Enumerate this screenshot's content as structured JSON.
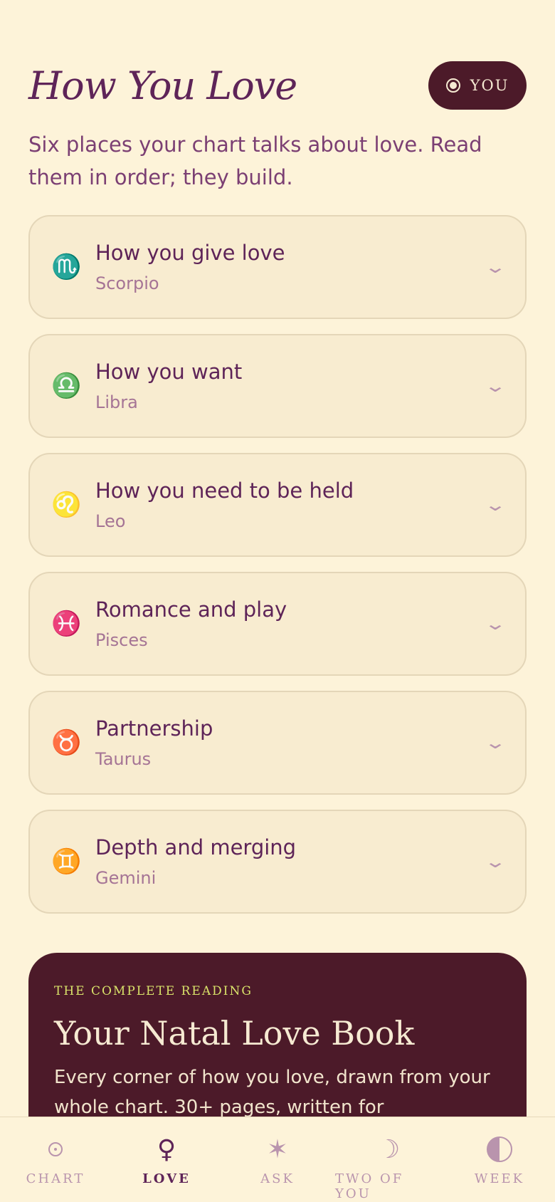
{
  "header": {
    "title": "How You Love",
    "you_button": "YOU"
  },
  "intro": "Six places your chart talks about love. Read them in order; they build.",
  "cards": [
    {
      "glyph": "♏",
      "icon": "scorpio-icon",
      "title": "How you give love",
      "sign": "Scorpio"
    },
    {
      "glyph": "♎",
      "icon": "libra-icon",
      "title": "How you want",
      "sign": "Libra"
    },
    {
      "glyph": "♌",
      "icon": "leo-icon",
      "title": "How you need to be held",
      "sign": "Leo"
    },
    {
      "glyph": "♓",
      "icon": "pisces-icon",
      "title": "Romance and play",
      "sign": "Pisces"
    },
    {
      "glyph": "♉",
      "icon": "taurus-icon",
      "title": "Partnership",
      "sign": "Taurus"
    },
    {
      "glyph": "♊",
      "icon": "gemini-icon",
      "title": "Depth and merging",
      "sign": "Gemini"
    }
  ],
  "chevron": "⌄",
  "promo": {
    "kicker": "THE COMPLETE READING",
    "title": "Your Natal Love Book",
    "body": "Every corner of how you love, drawn from your whole chart. 30+ pages, written for"
  },
  "tabs": [
    {
      "label": "CHART",
      "icon": "chart-icon",
      "glyph": ""
    },
    {
      "label": "LOVE",
      "icon": "venus-icon",
      "glyph": "♀"
    },
    {
      "label": "ASK",
      "icon": "star-icon",
      "glyph": "✶"
    },
    {
      "label": "TWO OF YOU",
      "icon": "moon-icon",
      "glyph": "☽"
    },
    {
      "label": "WEEK",
      "icon": "half-moon-icon",
      "glyph": ""
    }
  ],
  "colors": {
    "background": "#fdf3d9",
    "accent": "#5e2458",
    "dark": "#4c1a29",
    "kicker": "#d9e36a"
  }
}
